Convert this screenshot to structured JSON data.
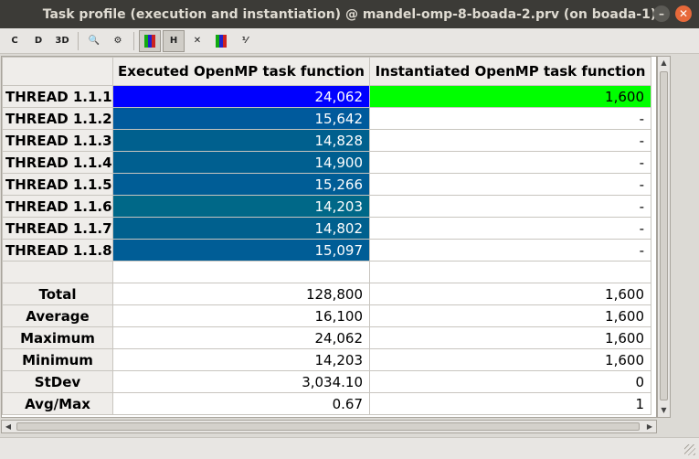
{
  "window": {
    "title": "Task profile (execution and instantiation) @ mandel-omp-8-boada-2.prv (on boada-1)",
    "minimize_symbol": "–",
    "close_symbol": "✕"
  },
  "toolbar": {
    "buttons": [
      {
        "name": "open-control-window",
        "icon": "ctrl-window-icon",
        "label": "C"
      },
      {
        "name": "open-data-window",
        "icon": "data-window-icon",
        "label": "D"
      },
      {
        "name": "3d-toggle",
        "icon": "3d-icon",
        "label": "3D"
      },
      {
        "name": "zoom",
        "icon": "magnifier-icon",
        "label": "🔍"
      },
      {
        "name": "settings",
        "icon": "gear-icon",
        "label": "⚙"
      },
      {
        "name": "color-mode",
        "icon": "color-bars-icon",
        "label": ""
      },
      {
        "name": "horizontal",
        "icon": "horizontal-icon",
        "label": "H"
      },
      {
        "name": "hide-empty",
        "icon": "hide-empty-icon",
        "label": "✕"
      },
      {
        "name": "semantic-color",
        "icon": "semantic-bars-icon",
        "label": ""
      },
      {
        "name": "fraction",
        "icon": "fraction-icon",
        "label": "⅟"
      }
    ]
  },
  "table": {
    "columns": [
      "Executed OpenMP task function",
      "Instantiated OpenMP task function"
    ],
    "rows": [
      {
        "label": "THREAD 1.1.1",
        "values": [
          "24,062",
          "1,600"
        ],
        "colors": [
          "#0000ff",
          "#00ff00"
        ],
        "text_colors": [
          "#ffffff",
          "#000000"
        ]
      },
      {
        "label": "THREAD 1.1.2",
        "values": [
          "15,642",
          "-"
        ],
        "colors": [
          "#005a9c",
          "#ffffff"
        ],
        "text_colors": [
          "#ffffff",
          "#000000"
        ]
      },
      {
        "label": "THREAD 1.1.3",
        "values": [
          "14,828",
          "-"
        ],
        "colors": [
          "#00608e",
          "#ffffff"
        ],
        "text_colors": [
          "#ffffff",
          "#000000"
        ]
      },
      {
        "label": "THREAD 1.1.4",
        "values": [
          "14,900",
          "-"
        ],
        "colors": [
          "#005f90",
          "#ffffff"
        ],
        "text_colors": [
          "#ffffff",
          "#000000"
        ]
      },
      {
        "label": "THREAD 1.1.5",
        "values": [
          "15,266",
          "-"
        ],
        "colors": [
          "#005d96",
          "#ffffff"
        ],
        "text_colors": [
          "#ffffff",
          "#000000"
        ]
      },
      {
        "label": "THREAD 1.1.6",
        "values": [
          "14,203",
          "-"
        ],
        "colors": [
          "#006888",
          "#ffffff"
        ],
        "text_colors": [
          "#ffffff",
          "#000000"
        ]
      },
      {
        "label": "THREAD 1.1.7",
        "values": [
          "14,802",
          "-"
        ],
        "colors": [
          "#00608e",
          "#ffffff"
        ],
        "text_colors": [
          "#ffffff",
          "#000000"
        ]
      },
      {
        "label": "THREAD 1.1.8",
        "values": [
          "15,097",
          "-"
        ],
        "colors": [
          "#005d96",
          "#ffffff"
        ],
        "text_colors": [
          "#ffffff",
          "#000000"
        ]
      }
    ],
    "stats": [
      {
        "label": "Total",
        "values": [
          "128,800",
          "1,600"
        ]
      },
      {
        "label": "Average",
        "values": [
          "16,100",
          "1,600"
        ]
      },
      {
        "label": "Maximum",
        "values": [
          "24,062",
          "1,600"
        ]
      },
      {
        "label": "Minimum",
        "values": [
          "14,203",
          "1,600"
        ]
      },
      {
        "label": "StDev",
        "values": [
          "3,034.10",
          "0"
        ]
      },
      {
        "label": "Avg/Max",
        "values": [
          "0.67",
          "1"
        ]
      }
    ]
  }
}
